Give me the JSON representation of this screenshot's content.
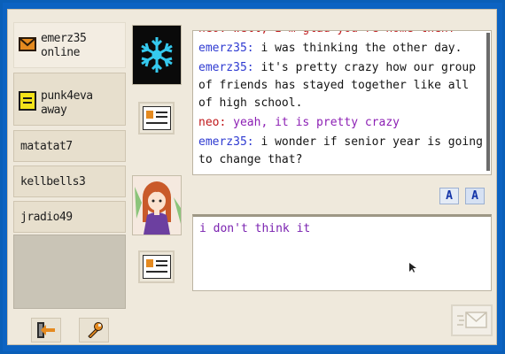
{
  "buddies": [
    {
      "name": "emerz35",
      "status": "online",
      "icon": "envelope-icon"
    },
    {
      "name": "punk4eva",
      "status": "away",
      "icon": "note-icon"
    },
    {
      "name": "matatat7"
    },
    {
      "name": "kellbells3"
    },
    {
      "name": "jradio49"
    }
  ],
  "sidebar_buttons": [
    {
      "icon": "exit-door-icon"
    },
    {
      "icon": "wrench-icon"
    }
  ],
  "chat": {
    "cut_line": "neo: well, I'm glad you're home then!",
    "messages": [
      {
        "user": "emerz35",
        "text": "i was thinking the other day."
      },
      {
        "user": "emerz35",
        "text": "it's pretty crazy how our group of friends has stayed together like all of high school."
      },
      {
        "user": "neo",
        "text": "yeah, it is pretty crazy"
      },
      {
        "user": "emerz35",
        "text": "i wonder if senior year is going to change that?"
      }
    ]
  },
  "format_buttons": [
    {
      "label": "A",
      "icon": "font-icon"
    },
    {
      "label": "A",
      "icon": "font-color-icon"
    }
  ],
  "input": {
    "value": "i don't think it"
  },
  "colors": {
    "emerz_name": "#2f3bd1",
    "neo_name": "#c0181b",
    "neo_text": "#8c1fb4",
    "background": "#0c63c2"
  }
}
